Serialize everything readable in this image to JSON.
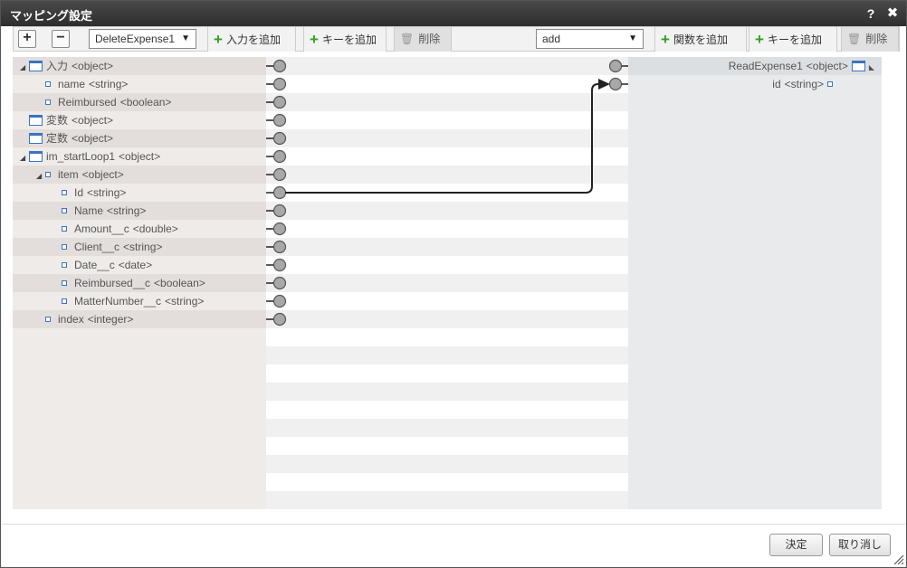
{
  "window": {
    "title": "マッピング設定",
    "help_label": "?",
    "close_label": "✖"
  },
  "toolbar_left": {
    "expand_label": "+",
    "collapse_label": "−",
    "selected_source": "DeleteExpense1",
    "add_input_label": "入力を追加",
    "add_key_label": "キーを追加",
    "delete_label": "削除"
  },
  "toolbar_right": {
    "selected_function": "add",
    "add_function_label": "関数を追加",
    "add_key_label": "キーを追加",
    "delete_label": "削除"
  },
  "input_tree": [
    {
      "label": "入力",
      "type": "<object>",
      "kind": "object",
      "depth": 0,
      "toggle": "◢"
    },
    {
      "label": "name",
      "type": "<string>",
      "kind": "prop",
      "depth": 1
    },
    {
      "label": "Reimbursed",
      "type": "<boolean>",
      "kind": "prop",
      "depth": 1
    },
    {
      "label": "変数",
      "type": "<object>",
      "kind": "object",
      "depth": 0
    },
    {
      "label": "定数",
      "type": "<object>",
      "kind": "object",
      "depth": 0
    },
    {
      "label": "im_startLoop1",
      "type": "<object>",
      "kind": "object",
      "depth": 0,
      "toggle": "◢"
    },
    {
      "label": "item",
      "type": "<object>",
      "kind": "prop",
      "depth": 1,
      "toggle": "◢"
    },
    {
      "label": "Id",
      "type": "<string>",
      "kind": "prop",
      "depth": 2
    },
    {
      "label": "Name",
      "type": "<string>",
      "kind": "prop",
      "depth": 2
    },
    {
      "label": "Amount__c",
      "type": "<double>",
      "kind": "prop",
      "depth": 2
    },
    {
      "label": "Client__c",
      "type": "<string>",
      "kind": "prop",
      "depth": 2
    },
    {
      "label": "Date__c",
      "type": "<date>",
      "kind": "prop",
      "depth": 2
    },
    {
      "label": "Reimbursed__c",
      "type": "<boolean>",
      "kind": "prop",
      "depth": 2
    },
    {
      "label": "MatterNumber__c",
      "type": "<string>",
      "kind": "prop",
      "depth": 2
    },
    {
      "label": "index",
      "type": "<integer>",
      "kind": "prop",
      "depth": 1
    }
  ],
  "output_tree": [
    {
      "label": "ReadExpense1",
      "type": "<object>",
      "kind": "object",
      "toggle": "◣"
    },
    {
      "label": "id",
      "type": "<string>",
      "kind": "prop"
    }
  ],
  "mapping": {
    "from": "Id",
    "to": "id"
  },
  "footer": {
    "ok_label": "決定",
    "cancel_label": "取り消し"
  },
  "colors": {
    "titlebar": "#3a3a3a",
    "link_line": "#222222",
    "connector_fill": "#a8a8a8",
    "add_icon": "#3a9a2a"
  }
}
